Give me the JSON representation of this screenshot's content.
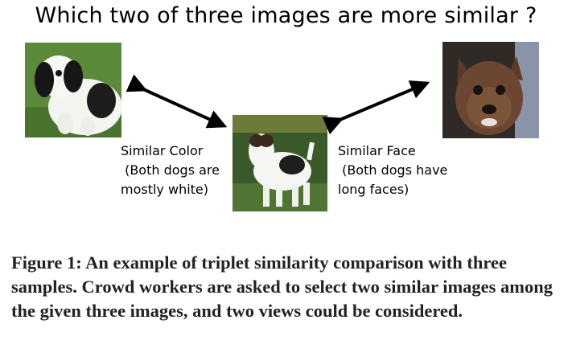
{
  "figure": {
    "title": "Which two of three images are more similar ?",
    "images": {
      "left": "japanese-chin-dog-photo",
      "center": "wire-fox-terrier-photo",
      "right": "brown-terrier-face-photo"
    },
    "labels": {
      "left": "Similar Color\n (Both dogs are\nmostly white)",
      "right": "Similar Face\n (Both dogs have\nlong faces)"
    },
    "caption": "Figure 1: An example of triplet similarity comparison with three samples. Crowd workers are asked to select two similar images among the given three images, and two views could be considered."
  }
}
